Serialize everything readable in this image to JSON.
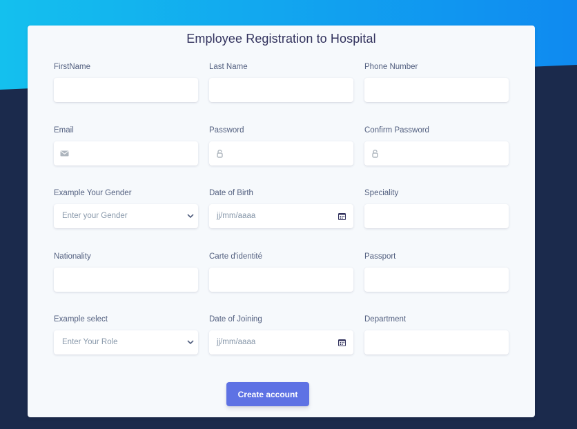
{
  "form": {
    "title": "Employee Registration to Hospital",
    "submit_label": "Create account",
    "fields": {
      "first_name": {
        "label": "FirstName",
        "value": ""
      },
      "last_name": {
        "label": "Last Name",
        "value": ""
      },
      "phone": {
        "label": "Phone Number",
        "value": ""
      },
      "email": {
        "label": "Email",
        "value": "",
        "icon": "envelope-icon"
      },
      "password": {
        "label": "Password",
        "value": "",
        "icon": "lock-icon"
      },
      "confirm_password": {
        "label": "Confirm Password",
        "value": "",
        "icon": "lock-icon"
      },
      "gender": {
        "label": "Example Your Gender",
        "placeholder": "Enter your Gender"
      },
      "dob": {
        "label": "Date of Birth",
        "placeholder": "jj/mm/aaaa"
      },
      "speciality": {
        "label": "Speciality",
        "value": ""
      },
      "nationality": {
        "label": "Nationality",
        "value": ""
      },
      "id_card": {
        "label": "Carte d'identité",
        "value": ""
      },
      "passport": {
        "label": "Passport",
        "value": ""
      },
      "role": {
        "label": "Example select",
        "placeholder": "Enter Your Role"
      },
      "joining": {
        "label": "Date of Joining",
        "placeholder": "jj/mm/aaaa"
      },
      "department": {
        "label": "Department",
        "value": ""
      }
    }
  },
  "colors": {
    "accent": "#5e72e4",
    "background": "#1b2a4c",
    "gradient_start": "#14c0ee",
    "gradient_end": "#0f8af0",
    "card": "#f6f9fc"
  }
}
